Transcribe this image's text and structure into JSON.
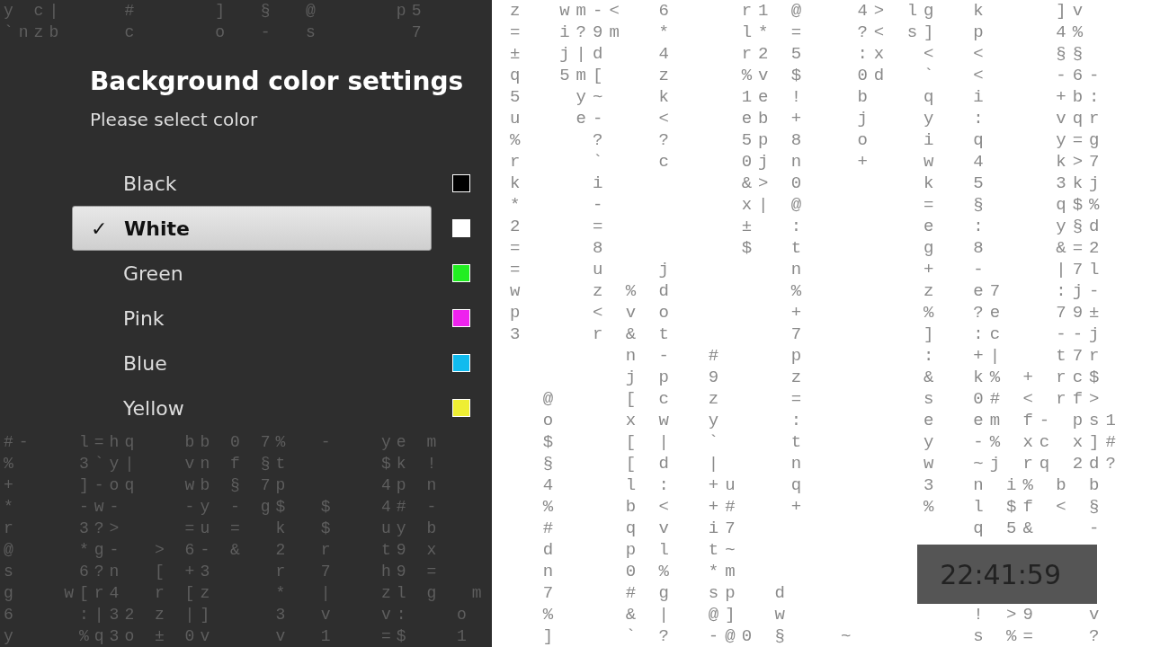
{
  "menu": {
    "title": "Background color settings",
    "subtitle": "Please select color",
    "items": [
      {
        "label": "Black",
        "selected": false,
        "color": "#000000"
      },
      {
        "label": "White",
        "selected": true,
        "color": "#ffffff"
      },
      {
        "label": "Green",
        "selected": false,
        "color": "#22ee22"
      },
      {
        "label": "Pink",
        "selected": false,
        "color": "#ee22ee"
      },
      {
        "label": "Blue",
        "selected": false,
        "color": "#11bbee"
      },
      {
        "label": "Yellow",
        "selected": false,
        "color": "#eeee33"
      }
    ],
    "check": "✓"
  },
  "clock": {
    "time": "22:41:59"
  },
  "matrix": {
    "left_top_rows": [
      "y c|    #     ]  §  @     p5",
      "`nzb    c     o  -  s      7"
    ],
    "left_bottom_rows": [
      "#-   l=hq   bb 0 7%  -   ye m",
      "%    3`y|   vn f §t      $k !",
      "+    ]-oq   wb § 7p      4p n",
      "*    -w-    -y - g$  $   4# -",
      "r    3?>    =u =  k  $   uy b",
      "@    *g-  > 6- &  2  r   t9 x",
      "s    6?n  [ +3    r  7   h9 =",
      "g   w[r4  r [z    *  |   zl g  m",
      "6    :|32 z |]    3  v   v:   o",
      "y    %q3o ± 0v    v  1   =$   1"
    ],
    "right_rows": [
      "z  wm-<  6    r1 @   4> lg  k    ]v",
      "=  i?9m  *    l* =   ?< s]  p    4%",
      "±  j|d   4    r2 5   :x  <  <    §§",
      "q  5m[   z    %v $   0d  `  <    -6-",
      "5   y~   k    1e !   b   q  i    +b:",
      "u   e-   <    eb +   j   y  :    vqr",
      "%    ?   ?    5p 8   o   i  q    y=g",
      "r    `   c    0j n   +   w  4    k>7",
      "k    i        &> 0       k  5    3kj",
      "*    -        x| @       =  §    q$%",
      "2    =        ±  :       e  :    y§d",
      "=    8        $  t       g  8    &=2",
      "=    u   j       n       +  -    |7l",
      "w    z % d       %       z  e7   :j-",
      "p    < v o       +       %  ?e   79±",
      "3    r & t       7       ]  :c   --j",
      "       n -  #    p       :  +|   t7r",
      "       j p  9    z       &  k% + rc$",
      "  @    [ c  z    =       s  0# < rf>",
      "  o    x w  y    :       e  em f- ps1",
      "  $    [ |  `    t       y  -% xc x]#",
      "  §    [ d  |    n       w  ~j rq 2d?",
      "  4    l :  +u   q       3  n i% b b",
      "  %    b <  +#   +       %  l $f < §",
      "  #    q v  i7              q 5&   -",
      "  d    p l  t~",
      "  n    0 %  *m",
      "  7    # g  sp  d",
      "  %    & |  @]  w           ! >9   v",
      "  ]    ` ?  -@0 §   ~       s %=   ?"
    ]
  }
}
